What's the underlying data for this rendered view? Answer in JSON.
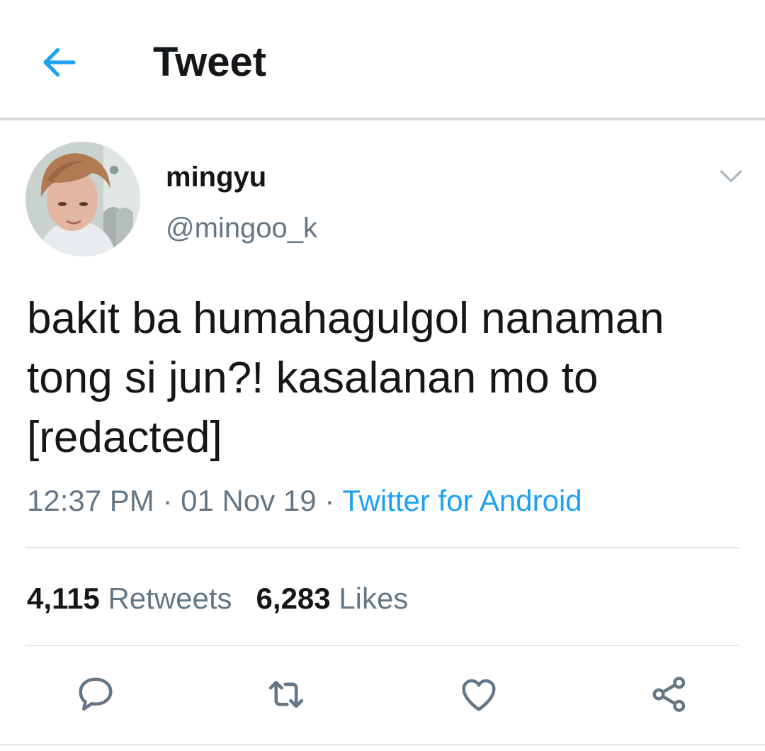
{
  "header": {
    "back_icon": "arrow-left-icon",
    "title": "Tweet"
  },
  "tweet": {
    "author": {
      "display_name": "mingyu",
      "handle": "@mingoo_k"
    },
    "text": "bakit ba humahagulgol nanaman tong si jun?! kasalanan mo to [redacted]",
    "time": "12:37 PM",
    "separator": "·",
    "date": "01 Nov 19",
    "source": "Twitter for Android",
    "stats": {
      "retweets_count": "4,115",
      "retweets_label": "Retweets",
      "likes_count": "6,283",
      "likes_label": "Likes"
    },
    "actions": [
      "reply-icon",
      "retweet-icon",
      "like-icon",
      "share-icon"
    ]
  },
  "colors": {
    "accent": "#1da1f2",
    "text_primary": "#14171a",
    "text_secondary": "#657786",
    "divider": "#e1e8ed",
    "icon": "#657786"
  }
}
